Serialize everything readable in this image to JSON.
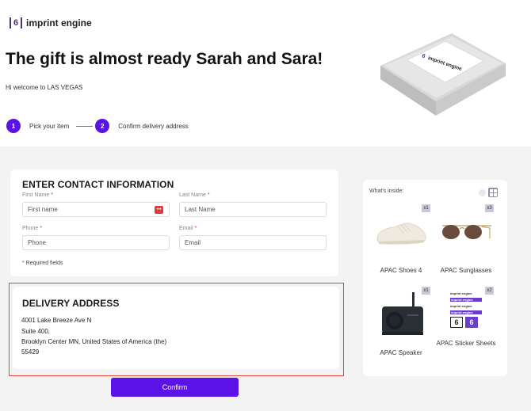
{
  "brand": {
    "mark": "6",
    "name": "imprint engine"
  },
  "hero": {
    "headline": "The gift is almost ready Sarah and Sara!",
    "welcome": "Hi welcome to LAS VEGAS"
  },
  "steps": [
    {
      "number": "1",
      "label": "Pick your item"
    },
    {
      "number": "2",
      "label": "Confirm delivery address"
    }
  ],
  "box": {
    "logo_mark": "6",
    "logo_text": "imprint engine"
  },
  "contact": {
    "title": "ENTER CONTACT INFORMATION",
    "first_name": {
      "label": "First Name",
      "placeholder": "First name",
      "value": ""
    },
    "last_name": {
      "label": "Last Name",
      "placeholder": "Last Name",
      "value": ""
    },
    "phone": {
      "label": "Phone",
      "placeholder": "Phone",
      "value": ""
    },
    "email": {
      "label": "Email",
      "placeholder": "Email",
      "value": ""
    },
    "required_asterisk": "*",
    "required_note": "Required fields",
    "password_badge": "•••"
  },
  "delivery": {
    "title": "DELIVERY ADDRESS",
    "lines": [
      "4001 Lake Breeze Ave N",
      "Suite 400,",
      "Brooklyn Center MN, United States of America (the)",
      "55429"
    ]
  },
  "confirm_label": "Confirm",
  "inside": {
    "title": "What's inside:",
    "items": [
      {
        "name": "APAC Shoes 4",
        "qty": "x1"
      },
      {
        "name": "APAC Sunglasses",
        "qty": "x3"
      },
      {
        "name": "APAC Speaker",
        "qty": "x1"
      },
      {
        "name": "APAC Sticker Sheets",
        "qty": "x2"
      }
    ],
    "sticker_text": "imprint engine",
    "sticker_mark": "6"
  },
  "colors": {
    "accent": "#5b12e6",
    "brand": "#4b2e83",
    "highlight": "#e5473d"
  }
}
